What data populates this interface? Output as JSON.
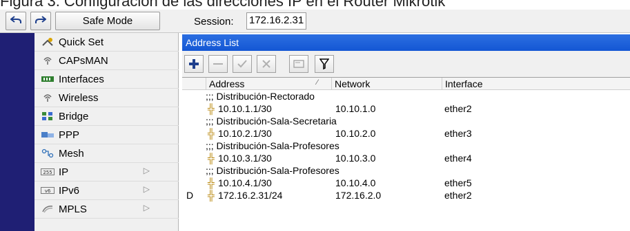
{
  "caption_fragment": "Figura 3. Configuración de las direcciones IP en el Router Mikrotik",
  "toolbar": {
    "undo_icon": "undo-icon",
    "redo_icon": "redo-icon",
    "safe_mode_label": "Safe Mode",
    "session_label": "Session:",
    "session_value": "172.16.2.31"
  },
  "sidebar": {
    "items": [
      {
        "label": "Quick Set",
        "icon": "quick-set-icon"
      },
      {
        "label": "CAPsMAN",
        "icon": "capsman-icon"
      },
      {
        "label": "Interfaces",
        "icon": "interfaces-icon"
      },
      {
        "label": "Wireless",
        "icon": "wireless-icon"
      },
      {
        "label": "Bridge",
        "icon": "bridge-icon"
      },
      {
        "label": "PPP",
        "icon": "ppp-icon"
      },
      {
        "label": "Mesh",
        "icon": "mesh-icon"
      },
      {
        "label": "IP",
        "icon": "ip-icon",
        "submenu": true
      },
      {
        "label": "IPv6",
        "icon": "ipv6-icon",
        "submenu": true
      },
      {
        "label": "MPLS",
        "icon": "mpls-icon",
        "submenu": true
      }
    ]
  },
  "address_list": {
    "title": "Address List",
    "columns": [
      "Address",
      "Network",
      "Interface"
    ],
    "sort_indicator": "⁄",
    "rows": [
      {
        "type": "comment",
        "text": ";;; Distribución-Rectorado"
      },
      {
        "type": "entry",
        "flag": "",
        "address": "10.10.1.1/30",
        "network": "10.10.1.0",
        "interface": "ether2"
      },
      {
        "type": "comment",
        "text": ";;; Distribución-Sala-Secretaria"
      },
      {
        "type": "entry",
        "flag": "",
        "address": "10.10.2.1/30",
        "network": "10.10.2.0",
        "interface": "ether3"
      },
      {
        "type": "comment",
        "text": ";;; Distribución-Sala-Profesores"
      },
      {
        "type": "entry",
        "flag": "",
        "address": "10.10.3.1/30",
        "network": "10.10.3.0",
        "interface": "ether4"
      },
      {
        "type": "comment",
        "text": ";;; Distribución-Sala-Profesores"
      },
      {
        "type": "entry",
        "flag": "",
        "address": "10.10.4.1/30",
        "network": "10.10.4.0",
        "interface": "ether5"
      },
      {
        "type": "entry",
        "flag": "D",
        "address": "172.16.2.31/24",
        "network": "172.16.2.0",
        "interface": "ether2"
      }
    ]
  },
  "colors": {
    "rail": "#1f1f74",
    "title_bar": "#1457d4",
    "add_button": "#1e3f8c"
  }
}
